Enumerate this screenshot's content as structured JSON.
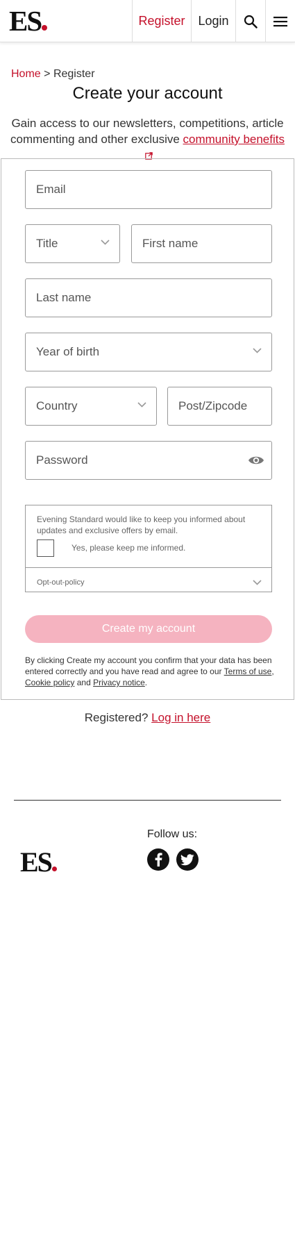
{
  "header": {
    "logo_text": "ES",
    "register_label": "Register",
    "login_label": "Login",
    "search_icon": "search-icon",
    "menu_icon": "hamburger-menu-icon"
  },
  "breadcrumb": {
    "home": "Home",
    "separator": ">",
    "current": "Register"
  },
  "page_title": "Create your account",
  "intro": {
    "text": "Gain access to our newsletters, competitions, article commenting and other exclusive",
    "link_text": "community benefits"
  },
  "form": {
    "email_placeholder": "Email",
    "title_placeholder": "Title",
    "first_name_placeholder": "First name",
    "last_name_placeholder": "Last name",
    "year_of_birth_placeholder": "Year of birth",
    "country_placeholder": "Country",
    "postcode_placeholder": "Post/Zipcode",
    "password_placeholder": "Password"
  },
  "consent": {
    "text": "Evening Standard would like to keep you informed about updates and exclusive offers by email.",
    "checkbox_label": "Yes, please keep me informed.",
    "checked": false,
    "optout_label": "Opt-out-policy"
  },
  "create_button_label": "Create my account",
  "legal": {
    "text": "By clicking Create my account you confirm that your data has been entered correctly and you have read and agree to our",
    "terms": "Terms of use",
    "comma": ",",
    "cookie": "Cookie policy",
    "and": "and",
    "privacy": "Privacy notice",
    "end": "."
  },
  "registered": {
    "text": "Registered?",
    "link": "Log in here"
  },
  "footer": {
    "logo_text": "ES",
    "follow_label": "Follow us:",
    "facebook_icon": "facebook-icon",
    "twitter_icon": "twitter-icon"
  },
  "colors": {
    "brand_red": "#c4102a",
    "button_disabled": "#f5b3c0"
  }
}
